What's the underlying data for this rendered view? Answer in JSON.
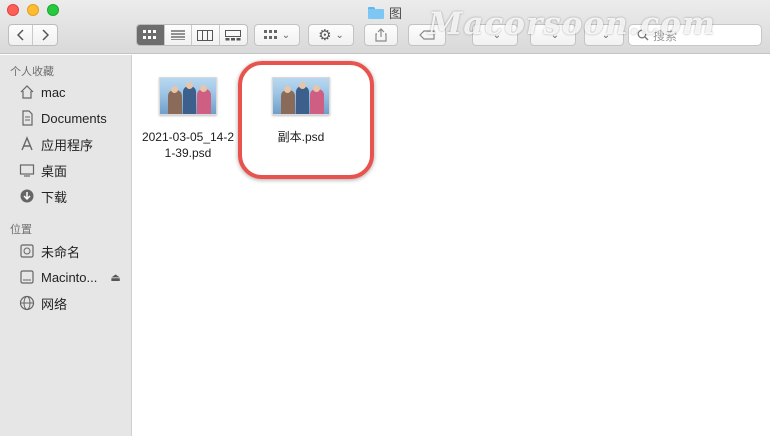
{
  "window": {
    "title": "图"
  },
  "toolbar": {
    "back_icon": "chevron-left-icon",
    "forward_icon": "chevron-right-icon",
    "view_modes": [
      "icon-view",
      "list-view",
      "column-view",
      "gallery-view"
    ],
    "active_view": "icon-view",
    "search_placeholder": "搜索"
  },
  "watermark": "Macorsoon.com",
  "sidebar": {
    "favorites_title": "个人收藏",
    "favorites": [
      {
        "label": "mac",
        "icon": "home-icon"
      },
      {
        "label": "Documents",
        "icon": "document-icon"
      },
      {
        "label": "应用程序",
        "icon": "applications-icon"
      },
      {
        "label": "桌面",
        "icon": "desktop-icon"
      },
      {
        "label": "下载",
        "icon": "download-icon"
      }
    ],
    "locations_title": "位置",
    "locations": [
      {
        "label": "未命名",
        "icon": "disk-icon"
      },
      {
        "label": "Macinto...",
        "icon": "disk-icon"
      },
      {
        "label": "网络",
        "icon": "network-icon"
      }
    ]
  },
  "files": [
    {
      "name": "2021-03-05_14-21-39.psd",
      "display": "2021-03-05_14-2\n1-39.psd"
    },
    {
      "name": "副本.psd",
      "display": "副本.psd"
    }
  ],
  "colors": {
    "highlight": "#e9534d",
    "sidebar_bg": "#e6e6e6",
    "folder": "#7ec6f4"
  }
}
